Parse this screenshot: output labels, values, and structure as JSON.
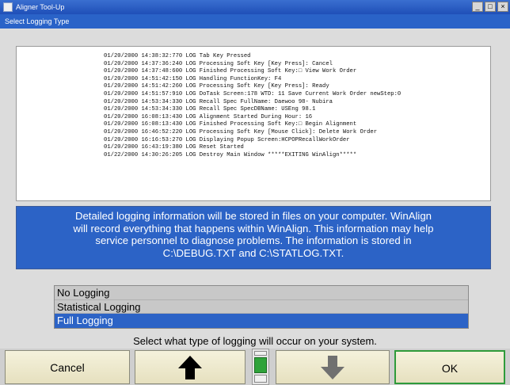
{
  "window": {
    "title": "Aligner Tool-Up",
    "minimize_glyph": "_",
    "maximize_glyph": "□",
    "close_glyph": "×"
  },
  "dialog": {
    "title": "Select Logging Type"
  },
  "log": {
    "lines": [
      "01/20/2000 14:38:32:770 LOG Tab Key Pressed",
      "01/20/2000 14:37:36:240 LOG Processing Soft Key [Key Press]: Cancel",
      "01/20/2000 14:37:48:600 LOG Finished Processing Soft Key:□ View Work Order",
      "01/20/2000 14:51:42:150 LOG Handling FunctionKey:  F4",
      "01/20/2000 14:51:42:260 LOG Processing Soft Key [Key Press]: Ready",
      "01/20/2000 14:51:57:910 LOG DoTask Screen:178 WTD: 11 Save Current Work Order newStep:0",
      "01/20/2000 14:53:34:330 LOG Recall Spec FullName: Daewoo 98- Nubira",
      "01/20/2000 14:53:34:330 LOG Recall Spec SpecDBName: USEng 98.1",
      "01/20/2000 16:08:13:430 LOG Alignment Started During Hour: 16",
      "01/20/2000 16:08:13:430 LOG Finished Processing Soft Key:□ Begin Alignment",
      "01/20/2000 16:46:52:220 LOG Processing Soft Key [Mouse Click]: Delete Work Order",
      "01/20/2000 16:16:53:270 LOG Displaying Popup Screen:HCPOPRecallWorkOrder",
      "01/20/2000 16:43:19:380 LOG Reset Started",
      "01/22/2000 14:30:26:205 LOG Destroy Main Window *****EXITING WinAlign*****"
    ]
  },
  "info": {
    "lines": [
      "Detailed logging information will be stored in files on your computer.  WinAlign",
      "will record everything that happens within WinAlign.  This information may help",
      "service personnel to diagnose problems.  The information is stored in",
      "C:\\DEBUG.TXT and C:\\STATLOG.TXT."
    ]
  },
  "logging_options": {
    "items": [
      "No Logging",
      "Statistical Logging",
      "Full Logging"
    ],
    "selected_index": 2
  },
  "prompt": "Select what type of logging will occur on your system.",
  "buttons": {
    "cancel": "Cancel",
    "up_icon": "up-arrow-icon",
    "down_icon": "down-arrow-icon",
    "ok": "OK"
  },
  "colors": {
    "titlebar": "#1f4fb8",
    "selection": "#2c63c6",
    "button_face": "#f5f2dc",
    "ok_border": "#2e9b3a",
    "scroll_thumb": "#2ea33a",
    "up_arrow": "#000000",
    "down_arrow": "#707070"
  }
}
